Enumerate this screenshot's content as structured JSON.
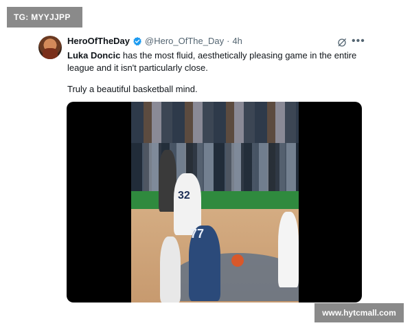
{
  "overlay": {
    "tag": "TG: MYYJJPP",
    "watermark": "www.hytcmall.com"
  },
  "tweet": {
    "display_name": "HeroOfTheDay",
    "handle": "@Hero_OfThe_Day",
    "separator": "·",
    "timestamp": "4h",
    "verified": true,
    "mention": "Luka Doncic",
    "text_rest": " has the most fluid, aesthetically pleasing game in the entire league and it isn't particularly close.",
    "text_line2": "Truly a beautiful basketball mind.",
    "icons": {
      "avatar": "avatar",
      "verified": "verified-badge-icon",
      "grok": "grok-icon",
      "more": "more-options-icon"
    },
    "media": {
      "jersey_numbers": [
        "32",
        "77"
      ]
    }
  },
  "colors": {
    "text_primary": "#0f1419",
    "text_secondary": "#536471",
    "verified_blue": "#1d9bf0",
    "overlay_gray": "#8a8a8a"
  }
}
